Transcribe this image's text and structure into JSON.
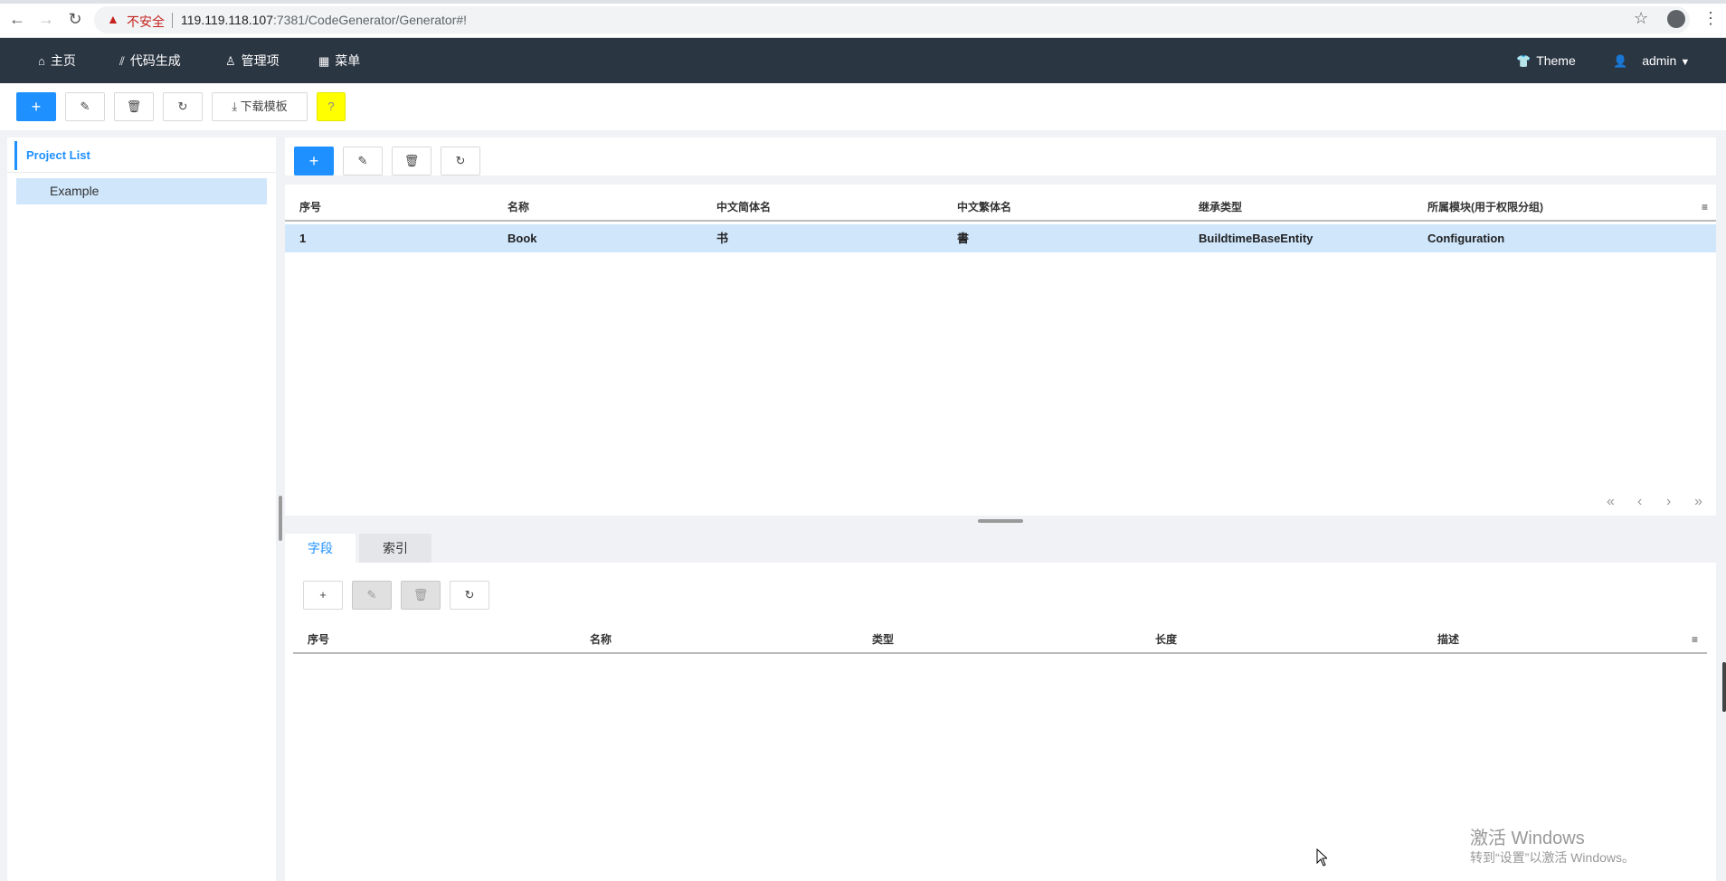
{
  "browser": {
    "security_warning": "不安全",
    "url_host": "119.119.118.107",
    "url_rest": ":7381/CodeGenerator/Generator#!"
  },
  "topnav": {
    "items": [
      {
        "label": "主页",
        "icon": "home-icon"
      },
      {
        "label": "代码生成",
        "icon": "chart-icon"
      },
      {
        "label": "管理项",
        "icon": "user-icon"
      },
      {
        "label": "菜单",
        "icon": "grid-icon"
      }
    ],
    "theme_label": "Theme",
    "user_label": "admin"
  },
  "toolbar": {
    "add": "+",
    "download_label": "下载模板",
    "help": "?"
  },
  "project_panel": {
    "title": "Project List",
    "items": [
      "Example"
    ]
  },
  "entity_grid": {
    "add": "+",
    "columns": [
      "序号",
      "名称",
      "中文简体名",
      "中文繁体名",
      "继承类型",
      "所属模块(用于权限分组)"
    ],
    "rows": [
      [
        "1",
        "Book",
        "书",
        "書",
        "BuildtimeBaseEntity",
        "Configuration"
      ]
    ],
    "pager": [
      "«",
      "‹",
      "›",
      "»"
    ]
  },
  "detail": {
    "tabs": [
      "字段",
      "索引"
    ],
    "add": "+",
    "columns": [
      "序号",
      "名称",
      "类型",
      "长度",
      "描述"
    ]
  },
  "watermark": {
    "line1": "激活 Windows",
    "line2": "转到“设置”以激活 Windows。"
  }
}
